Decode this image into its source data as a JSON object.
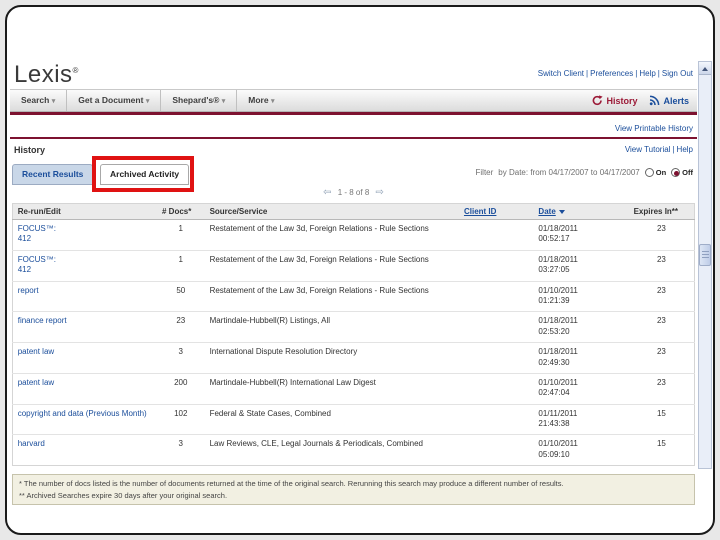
{
  "header": {
    "logo": "Lexis",
    "logo_mark": "®",
    "utility_links": [
      {
        "label": "Switch Client"
      },
      {
        "label": "Preferences"
      },
      {
        "label": "Help"
      },
      {
        "label": "Sign Out"
      }
    ]
  },
  "nav": {
    "menus": [
      {
        "label": "Search"
      },
      {
        "label": "Get a Document"
      },
      {
        "label": "Shepard's®"
      },
      {
        "label": "More"
      }
    ],
    "history_label": "History",
    "alerts_label": "Alerts"
  },
  "subheader": {
    "printable_link": "View Printable History",
    "title": "History",
    "tutorial_link": "View Tutorial",
    "help_link": "Help"
  },
  "tabs": [
    {
      "label": "Recent Results",
      "active": false
    },
    {
      "label": "Archived Activity",
      "active": true
    }
  ],
  "filter": {
    "label": "Filter",
    "by_date_text": "by Date: from 04/17/2007 to 04/17/2007",
    "on_label": "On",
    "off_label": "Off",
    "selected": "Off"
  },
  "pagination": {
    "range_text": "1 - 8 of 8"
  },
  "table": {
    "headers": {
      "rerun": "Re-run/Edit",
      "docs": "# Docs*",
      "source": "Source/Service",
      "client": "Client ID",
      "date": "Date",
      "expires": "Expires In**"
    },
    "rows": [
      {
        "name": "FOCUS™:",
        "name2": "412",
        "docs": "1",
        "source": "Restatement of the Law 3d, Foreign Relations - Rule Sections",
        "client": "",
        "date": "01/18/2011",
        "time": "00:52:17",
        "expires": "23"
      },
      {
        "name": "FOCUS™:",
        "name2": "412",
        "docs": "1",
        "source": "Restatement of the Law 3d, Foreign Relations - Rule Sections",
        "client": "",
        "date": "01/18/2011",
        "time": "03:27:05",
        "expires": "23"
      },
      {
        "name": "report",
        "name2": "",
        "docs": "50",
        "source": "Restatement of the Law 3d, Foreign Relations - Rule Sections",
        "client": "",
        "date": "01/10/2011",
        "time": "01:21:39",
        "expires": "23"
      },
      {
        "name": "finance report",
        "name2": "",
        "docs": "23",
        "source": "Martindale-Hubbell(R) Listings, All",
        "client": "",
        "date": "01/18/2011",
        "time": "02:53:20",
        "expires": "23"
      },
      {
        "name": "patent law",
        "name2": "",
        "docs": "3",
        "source": "International Dispute Resolution Directory",
        "client": "",
        "date": "01/18/2011",
        "time": "02:49:30",
        "expires": "23"
      },
      {
        "name": "patent law",
        "name2": "",
        "docs": "200",
        "source": "Martindale-Hubbell(R) International Law Digest",
        "client": "",
        "date": "01/10/2011",
        "time": "02:47:04",
        "expires": "23"
      },
      {
        "name": "copyright and data (Previous Month)",
        "name2": "",
        "docs": "102",
        "source": "Federal & State Cases, Combined",
        "client": "",
        "date": "01/11/2011",
        "time": "21:43:38",
        "expires": "15"
      },
      {
        "name": "harvard",
        "name2": "",
        "docs": "3",
        "source": "Law Reviews, CLE, Legal Journals & Periodicals, Combined",
        "client": "",
        "date": "01/10/2011",
        "time": "05:09:10",
        "expires": "15"
      }
    ]
  },
  "footnotes": [
    "* The number of docs listed is the number of documents returned at the time of the original search. Rerunning this search may produce a different number of results.",
    "** Archived Searches expire 30 days after your original search."
  ],
  "colors": {
    "maroon": "#7d1230",
    "link_blue": "#1b4e9b",
    "annotation_red": "#e01212"
  }
}
